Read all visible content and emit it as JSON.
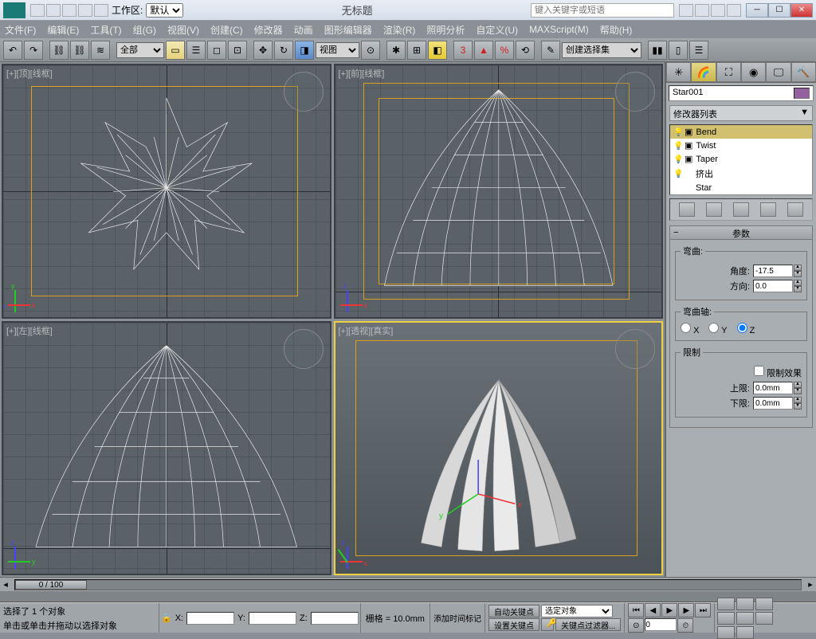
{
  "title": "无标题",
  "workspace_label": "工作区:",
  "workspace_value": "默认",
  "search_placeholder": "键入关键字或短语",
  "menus": [
    "文件(F)",
    "编辑(E)",
    "工具(T)",
    "组(G)",
    "视图(V)",
    "创建(C)",
    "修改器",
    "动画",
    "图形编辑器",
    "渲染(R)",
    "照明分析",
    "自定义(U)",
    "MAXScript(M)",
    "帮助(H)"
  ],
  "tb_select1": "全部",
  "tb_select2": "视图",
  "tb_selset": "创建选择集",
  "vps": {
    "tl": "[+][顶][线框]",
    "tr": "[+][前][线框]",
    "bl": "[+][左][线框]",
    "br": "[+][透视][真实]"
  },
  "cp": {
    "obj_name": "Star001",
    "modlist_label": "修改器列表",
    "mods": [
      "Bend",
      "Twist",
      "Taper",
      "挤出",
      "Star"
    ],
    "rollup_params": "参数",
    "bend_grp": "弯曲:",
    "angle_lbl": "角度:",
    "angle_val": "-17.5",
    "dir_lbl": "方向:",
    "dir_val": "0.0",
    "axis_grp": "弯曲轴:",
    "axis_x": "X",
    "axis_y": "Y",
    "axis_z": "Z",
    "limit_grp": "限制",
    "limit_eff": "限制效果",
    "upper_lbl": "上限:",
    "upper_val": "0.0mm",
    "lower_lbl": "下限:",
    "lower_val": "0.0mm"
  },
  "time_thumb": "0 / 100",
  "status": {
    "selected": "选择了 1 个对象",
    "prompt": "单击或单击并拖动以选择对象",
    "x": "X:",
    "y": "Y:",
    "z": "Z:",
    "grid": "栅格 = 10.0mm",
    "add_tag": "添加时间标记",
    "autokey": "自动关键点",
    "setkey": "设置关键点",
    "selobj": "选定对象",
    "keyfilter": "关键点过滤器...",
    "frame": "0"
  }
}
